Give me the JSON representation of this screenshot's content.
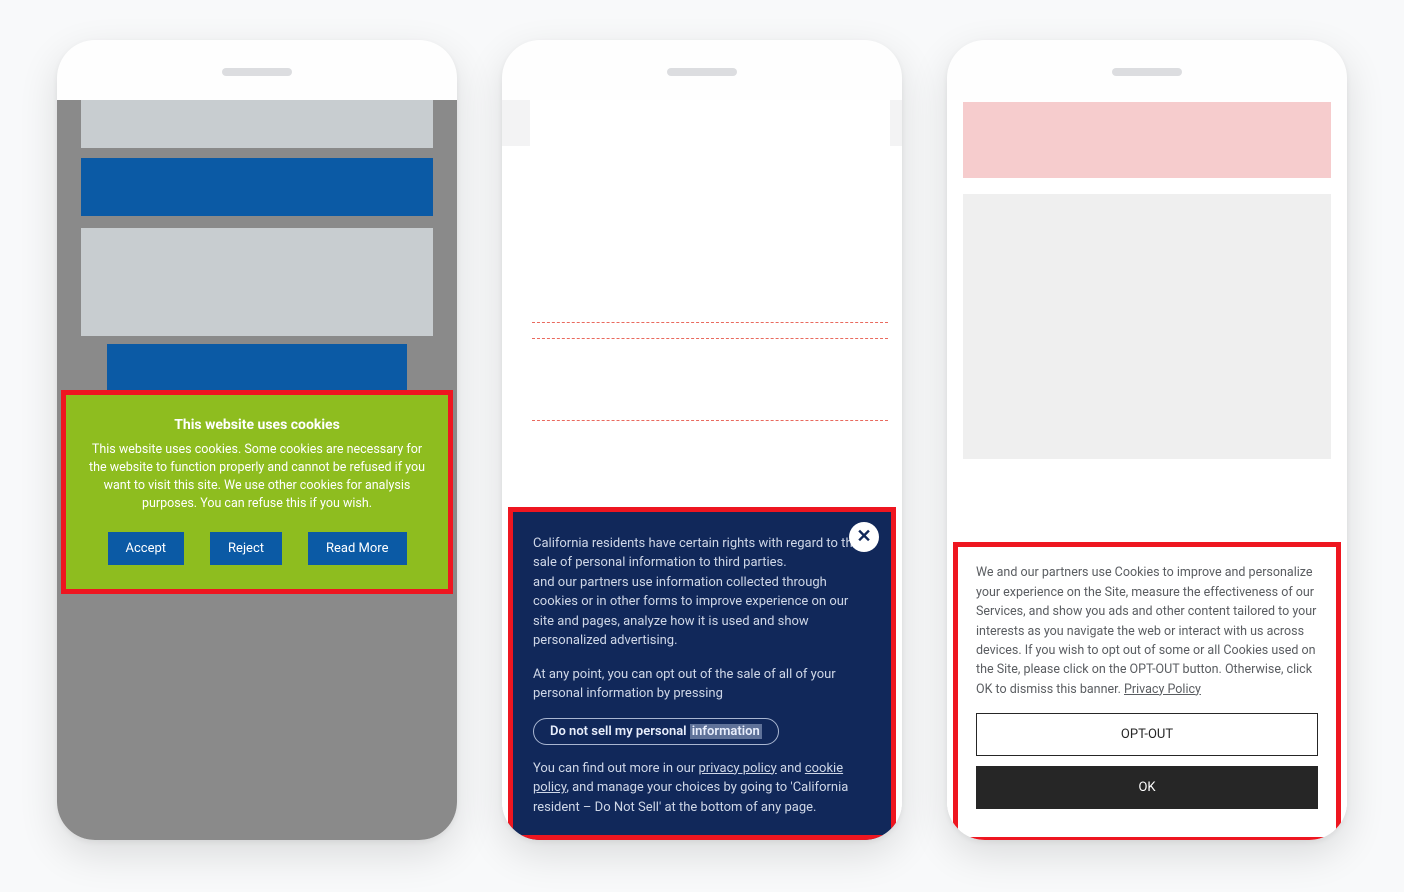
{
  "phone1": {
    "dialog": {
      "title": "This website uses cookies",
      "body": "This website uses cookies. Some cookies are necessary for the website to function properly and cannot be refused if you want to visit this site. We use other cookies for analysis purposes. You can refuse this if you wish.",
      "accept_label": "Accept",
      "reject_label": "Reject",
      "readmore_label": "Read More"
    }
  },
  "phone2": {
    "dialog": {
      "para1_a": "California residents have certain rights with regard to the sale of personal information to third parties.",
      "para1_b": "and our partners use information collected through cookies or in other forms to improve experience on our site and pages, analyze how it is used and show personalized advertising.",
      "para2": "At any point, you can opt out of the sale of all of your personal information by pressing",
      "dnsell_prefix": "Do not sell my personal ",
      "dnsell_hl": "information",
      "para3_a": "You can find out more in our ",
      "privacy_link": "privacy policy",
      "para3_b": " and ",
      "cookie_link": "cookie policy",
      "para3_c": ", and manage your choices by going to 'California resident – Do Not Sell' at the bottom of any page.",
      "close_glyph": "✕"
    }
  },
  "phone3": {
    "dialog": {
      "body_a": "We and our partners use Cookies to improve and personalize your experience on the Site, measure the effectiveness of our Services, and show you ads and other content tailored to your interests as you navigate the web or interact with us across devices. If you wish to opt out of some or all Cookies used on the Site, please click on the OPT-OUT button. Otherwise, click OK to dismiss this banner. ",
      "privacy_link": "Privacy Policy",
      "optout_label": "OPT-OUT",
      "ok_label": "OK"
    }
  }
}
